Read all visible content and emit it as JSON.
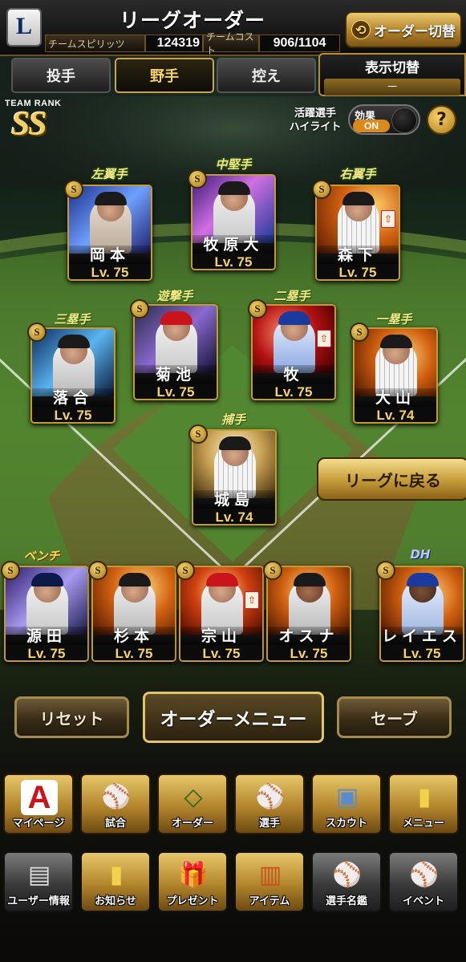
{
  "header": {
    "title": "リーグオーダー",
    "logo": "L",
    "spirit_label": "チームスピリッツ",
    "spirit_value": "124319",
    "cost_label": "チームコスト",
    "cost_value": "906/1104",
    "order_switch_label": "オーダー切替"
  },
  "tabs": [
    {
      "label": "投手",
      "active": false
    },
    {
      "label": "野手",
      "active": true
    },
    {
      "label": "控え",
      "active": false
    }
  ],
  "display_toggle": {
    "label": "表示切替",
    "value": "－"
  },
  "team_rank": {
    "label": "TEAM RANK",
    "value": "SS"
  },
  "highlight": {
    "label_line1": "活躍選手",
    "label_line2": "ハイライト",
    "toggle_label": "効果",
    "toggle_state": "ON",
    "help": "?"
  },
  "positions": {
    "left_field": "左翼手",
    "center_field": "中堅手",
    "right_field": "右翼手",
    "shortstop": "遊撃手",
    "second_base": "二塁手",
    "third_base": "三塁手",
    "first_base": "一塁手",
    "catcher": "捕手",
    "bench": "ベンチ",
    "dh": "DH"
  },
  "players": {
    "lf": {
      "name": "岡本",
      "level": "Lv. 75",
      "rank": "S"
    },
    "cf": {
      "name": "牧原大",
      "level": "Lv. 75",
      "rank": "S"
    },
    "rf": {
      "name": "森下",
      "level": "Lv. 75",
      "rank": "S"
    },
    "ss": {
      "name": "菊池",
      "level": "Lv. 75",
      "rank": "S"
    },
    "b2": {
      "name": "牧",
      "level": "Lv. 75",
      "rank": "S"
    },
    "b3": {
      "name": "落合",
      "level": "Lv. 75",
      "rank": "S"
    },
    "b1": {
      "name": "大山",
      "level": "Lv. 74",
      "rank": "S"
    },
    "c": {
      "name": "城島",
      "level": "Lv. 74",
      "rank": "S"
    },
    "bench1": {
      "name": "源田",
      "level": "Lv. 75",
      "rank": "S"
    },
    "bench2": {
      "name": "杉本",
      "level": "Lv. 75",
      "rank": "S"
    },
    "bench3": {
      "name": "宗山",
      "level": "Lv. 75",
      "rank": "S"
    },
    "bench4": {
      "name": "オスナ",
      "level": "Lv. 75",
      "rank": "S"
    },
    "dh": {
      "name": "レイエス",
      "level": "Lv. 75",
      "rank": "S"
    }
  },
  "buttons": {
    "back_to_league": "リーグに戻る",
    "reset": "リセット",
    "order_menu": "オーダーメニュー",
    "save": "セーブ"
  },
  "nav_row1": [
    {
      "label": "マイページ",
      "icon": "A"
    },
    {
      "label": "試合",
      "icon": "⚾"
    },
    {
      "label": "オーダー",
      "icon": "◇"
    },
    {
      "label": "選手",
      "icon": "⚾"
    },
    {
      "label": "スカウト",
      "icon": "▣"
    },
    {
      "label": "メニュー",
      "icon": "▮"
    }
  ],
  "nav_row2": [
    {
      "label": "ユーザー情報",
      "icon": "▤"
    },
    {
      "label": "お知らせ",
      "icon": "▮"
    },
    {
      "label": "プレゼント",
      "icon": "🎁"
    },
    {
      "label": "アイテム",
      "icon": "▥"
    },
    {
      "label": "選手名鑑",
      "icon": "⚾"
    },
    {
      "label": "イベント",
      "icon": "⚾"
    }
  ],
  "colors": {
    "accent_gold": "#c69a32",
    "tab_active": "#f6d36a",
    "toggle_on": "#d98a1a"
  }
}
